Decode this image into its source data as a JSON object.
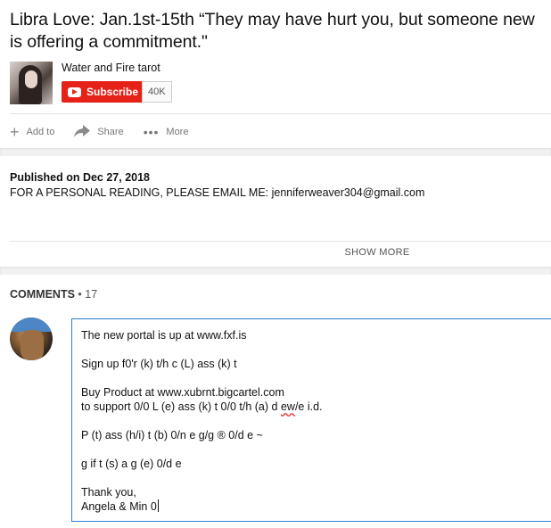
{
  "video": {
    "title": "Libra Love: Jan.1st-15th “They may have hurt you, but someone new is offering a commitment.\""
  },
  "channel": {
    "name": "Water and Fire tarot",
    "subscribe_label": "Subscribe",
    "subscriber_count": "40K"
  },
  "actions": {
    "add_to": "Add to",
    "share": "Share",
    "more": "More"
  },
  "description": {
    "published": "Published on Dec 27, 2018",
    "text": "FOR A PERSONAL READING, PLEASE EMAIL ME: jenniferweaver304@gmail.com",
    "show_more": "SHOW MORE"
  },
  "comments": {
    "label": "COMMENTS",
    "count": "• 17"
  },
  "comment_draft": {
    "p1": "The new portal is up at www.fxf.is",
    "p2": "Sign up f0'r (k) t/h c (L) ass (k) t",
    "p3_l1": "Buy Product at www.xubrnt.bigcartel.com",
    "p3_l2_pre": "to support 0/0 L (e) ass (k) t 0/0 t/h (a) d ",
    "p3_l2_err": "ew",
    "p3_l2_post": "/e i.d.",
    "p4": "P (t) ass (h/i) t (b) 0/n e g/g ® 0/d e ~",
    "p5": "g if t (s) a g (e) 0/d e",
    "p6_l1": "Thank you,",
    "p6_l2": "Angela & Min 0"
  },
  "colors": {
    "subscribe_red": "#e62117",
    "focus_blue": "#2b7fd1"
  }
}
